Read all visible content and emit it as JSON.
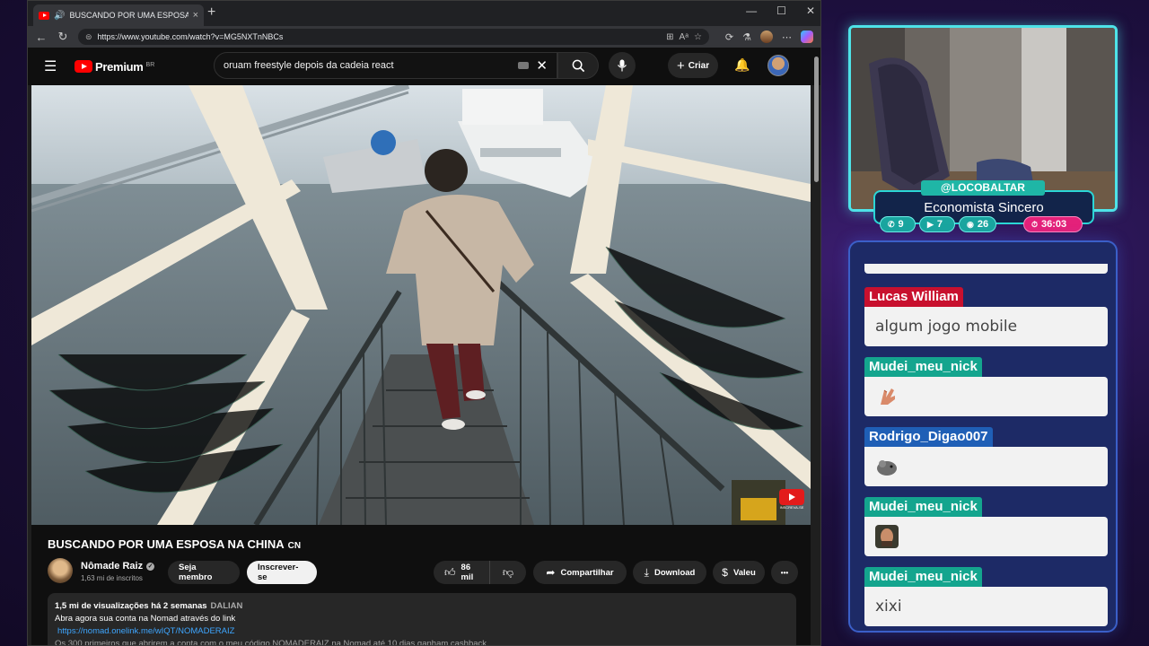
{
  "browser": {
    "tab_title": "BUSCANDO POR UMA ESPOSA",
    "tab_close": "×",
    "new_tab": "+",
    "url": "https://www.youtube.com/watch?v=MG5NXTnNBCs"
  },
  "youtube": {
    "logo_text": "Premium",
    "region": "BR",
    "search_query": "oruam freestyle depois da cadeia react",
    "create_label": "Criar"
  },
  "video": {
    "title": "BUSCANDO POR UMA ESPOSA NA CHINA",
    "title_flag": "CN",
    "subscribe_overlay": "INSCREVA-SE",
    "channel": {
      "name": "Nômade Raiz",
      "subscribers": "1,63 mi de inscritos"
    },
    "buttons": {
      "member": "Seja membro",
      "subscribe": "Inscrever-se",
      "likes": "86 mil",
      "share": "Compartilhar",
      "download": "Download",
      "thanks": "Valeu",
      "more": "•••"
    },
    "description": {
      "views_date": "1,5 mi de visualizações  há 2 semanas",
      "location_tag": "DALIAN",
      "line1": "Abra agora sua conta na Nomad através do link",
      "link": "https://nomad.onelink.me/wIQT/NOMADERAIZ",
      "line3": "Os 300 primeiros que abrirem a conta com o meu código NOMADERAIZ na Nomad até 10 dias ganham cashback..."
    }
  },
  "stream": {
    "handle": "@LOCOBALTAR",
    "subtitle": "Economista Sincero",
    "stats": [
      {
        "icon": "whatsapp-icon",
        "value": "9"
      },
      {
        "icon": "youtube-icon",
        "value": "7"
      },
      {
        "icon": "discord-icon",
        "value": "26"
      },
      {
        "icon": "timer-icon",
        "value": "36:03"
      }
    ]
  },
  "chat": {
    "messages": [
      {
        "user": "Lucas William",
        "color": "#c8102e",
        "text": "algum jogo mobile",
        "emote": null
      },
      {
        "user": "Mudei_meu_nick",
        "color": "#14a58e",
        "text": "",
        "emote": "hand-emote"
      },
      {
        "user": "Rodrigo_Digao007",
        "color": "#1f5fb6",
        "text": "",
        "emote": "rat-emote"
      },
      {
        "user": "Mudei_meu_nick",
        "color": "#14a58e",
        "text": "",
        "emote": "face-emote"
      },
      {
        "user": "Mudei_meu_nick",
        "color": "#14a58e",
        "text": "xixi",
        "emote": null
      }
    ]
  }
}
